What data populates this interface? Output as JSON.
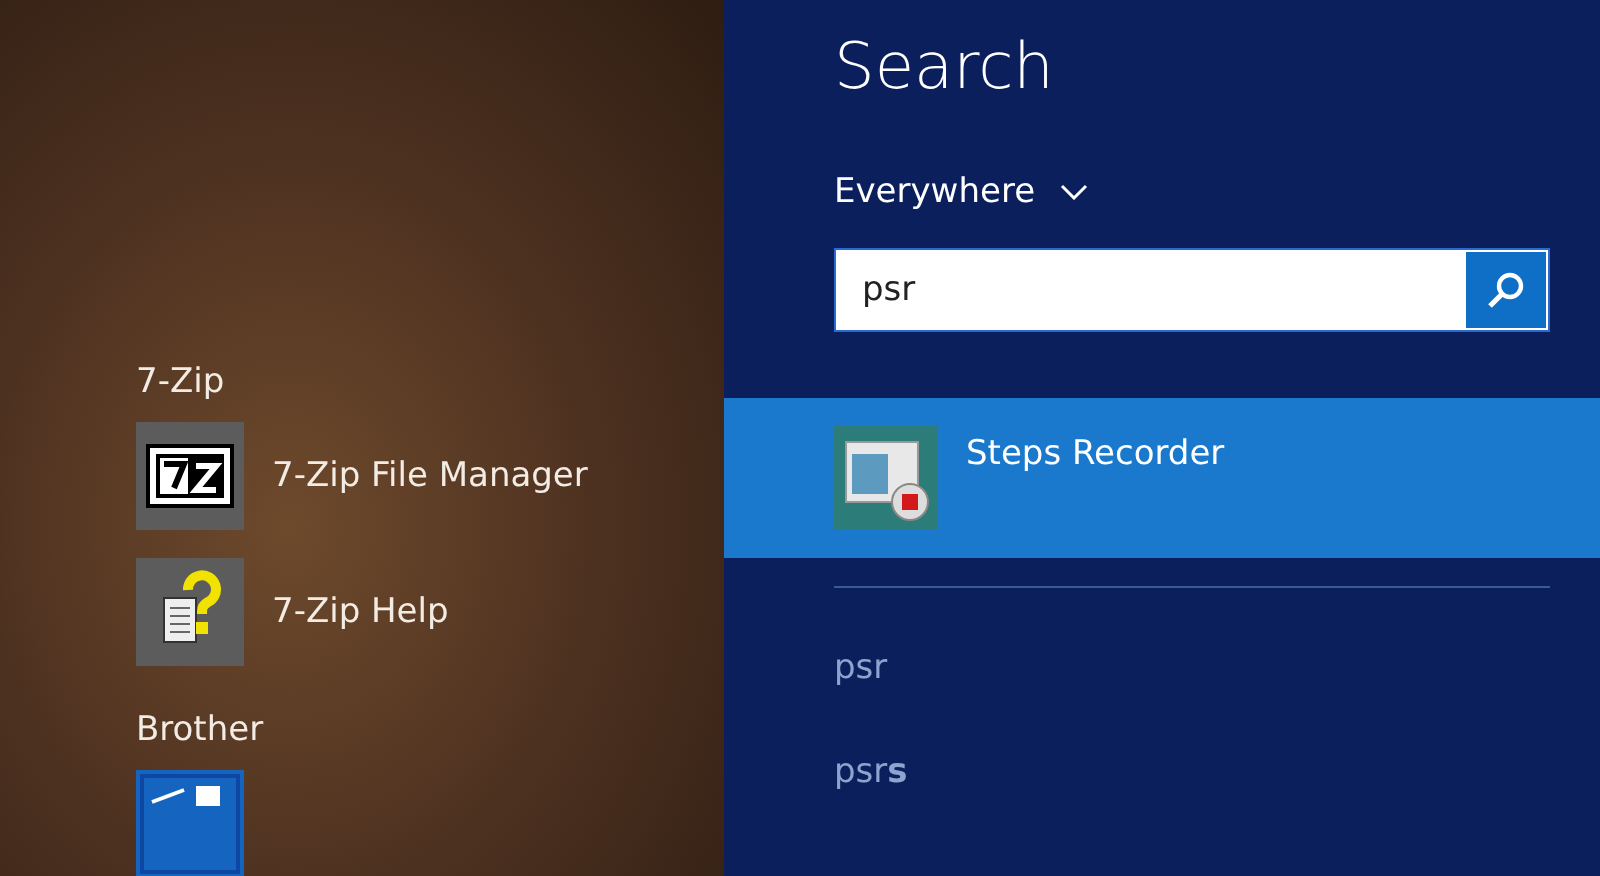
{
  "app_list": {
    "groups": [
      {
        "name": "7-Zip",
        "apps": [
          {
            "name": "7-Zip File Manager",
            "kind": "archive"
          },
          {
            "name": "7-Zip Help",
            "kind": "help"
          }
        ]
      },
      {
        "name": "Brother",
        "apps": [
          {
            "kind": "brother"
          }
        ]
      }
    ]
  },
  "search_pane": {
    "title": "Search",
    "scope": "Everywhere",
    "query": "psr",
    "results": [
      {
        "name": "Steps Recorder",
        "selected": true
      }
    ],
    "suggestions": [
      "psr",
      "psr**s**"
    ]
  }
}
